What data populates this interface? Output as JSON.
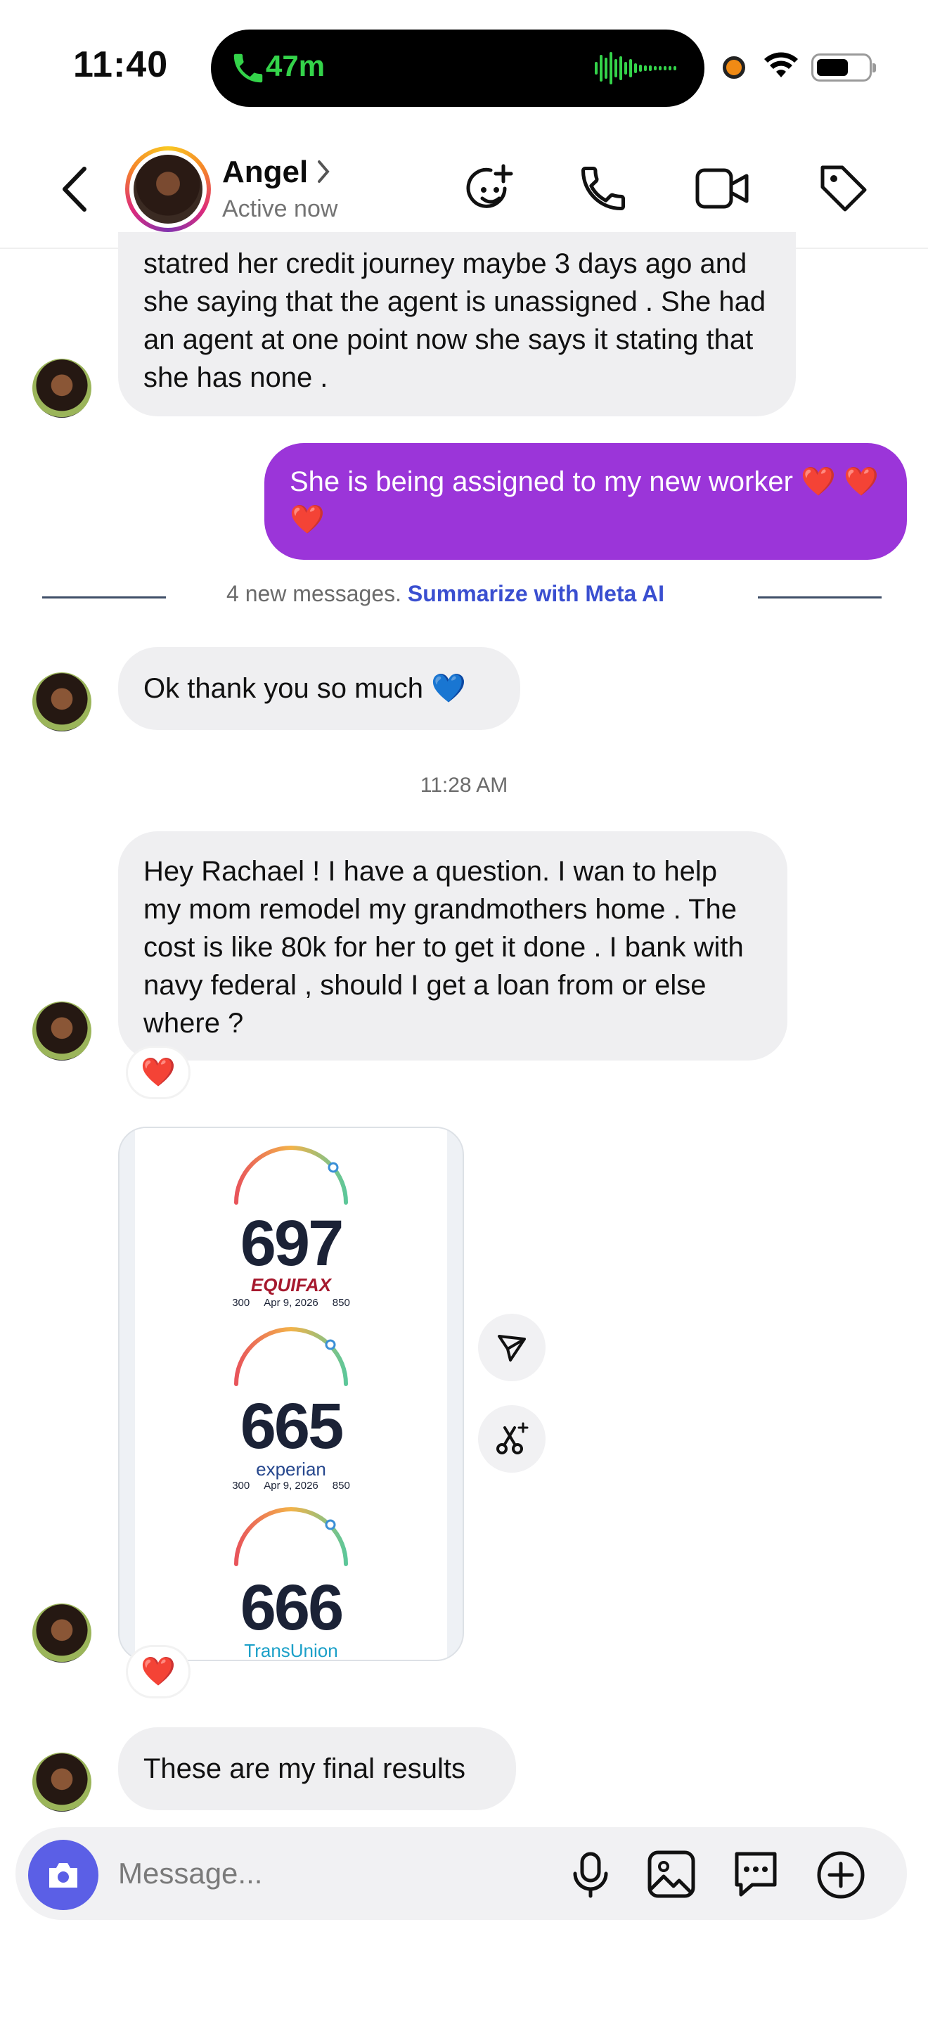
{
  "status_bar": {
    "time": "11:40",
    "call_duration": "47m"
  },
  "header": {
    "name": "Angel",
    "status": "Active now"
  },
  "messages": [
    {
      "from": "them",
      "text": "statred her credit journey maybe 3 days ago and she saying that the agent is unassigned . She had an agent at one point now she says it stating that she has none ."
    },
    {
      "from": "me",
      "text": "She is being assigned to my new worker ❤️ ❤️❤️"
    },
    {
      "from": "them",
      "text": "Ok thank you so much 💙"
    },
    {
      "from": "them",
      "text": "Hey Rachael ! I have a question. I wan to help my mom remodel my grandmothers home . The cost is like 80k for her to get it done . I bank with navy federal , should I get a loan from or else where ?",
      "reaction": "❤️"
    },
    {
      "from": "them",
      "type": "image",
      "reaction": "❤️"
    },
    {
      "from": "them",
      "text": "These are my final results"
    }
  ],
  "divider": {
    "text": "4 new messages.",
    "link": "Summarize with Meta AI"
  },
  "timestamp": "11:28 AM",
  "credit_image": {
    "scores": [
      {
        "value": "697",
        "bureau": "EQUIFAX",
        "min": "300",
        "date": "Apr 9, 2026",
        "max": "850"
      },
      {
        "value": "665",
        "bureau": "experian",
        "min": "300",
        "date": "Apr 9, 2026",
        "max": "850"
      },
      {
        "value": "666",
        "bureau": "TransUnion"
      }
    ]
  },
  "composer": {
    "placeholder": "Message..."
  },
  "colors": {
    "my_bubble": "#9b35d9",
    "their_bubble": "#efeff1",
    "link": "#3a4fd0",
    "camera": "#5b5fe6"
  }
}
